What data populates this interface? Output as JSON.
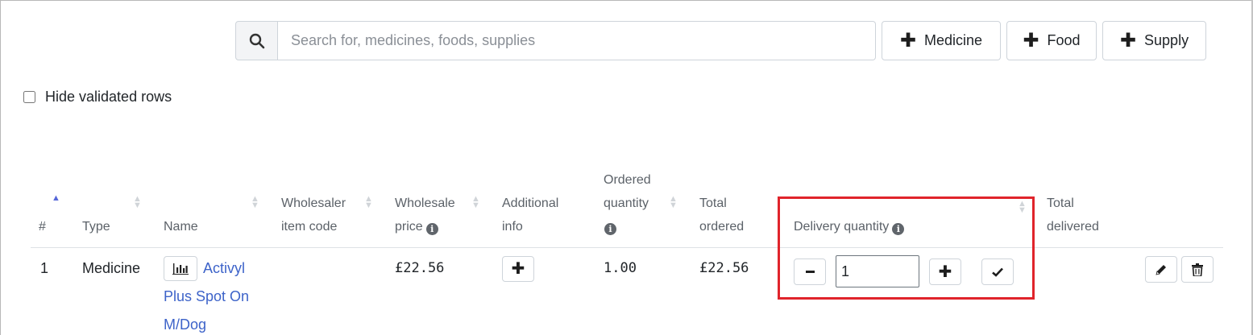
{
  "search": {
    "placeholder": "Search for, medicines, foods, supplies",
    "icon": "search-icon"
  },
  "add_buttons": {
    "medicine": "Medicine",
    "food": "Food",
    "supply": "Supply"
  },
  "filters": {
    "hide_validated_label": "Hide validated rows",
    "hide_validated_checked": false
  },
  "table": {
    "headers": {
      "index": "#",
      "type": "Type",
      "name": "Name",
      "wholesaler_code_1": "Wholesaler",
      "wholesaler_code_2": "item code",
      "wholesale_price_1": "Wholesale",
      "wholesale_price_2": "price",
      "additional_info_1": "Additional",
      "additional_info_2": "info",
      "ordered_qty_1": "Ordered",
      "ordered_qty_2": "quantity",
      "total_ordered_1": "Total",
      "total_ordered_2": "ordered",
      "delivery_qty": "Delivery quantity",
      "total_delivered_1": "Total",
      "total_delivered_2": "delivered"
    },
    "sort": {
      "column": "index",
      "direction": "ascending"
    },
    "rows": [
      {
        "index": "1",
        "type": "Medicine",
        "name_line1": "Activyl",
        "name_line2": "Plus Spot On",
        "name_line3": "M/Dog",
        "wholesaler_item_code": "",
        "wholesale_price": "£22.56",
        "ordered_quantity": "1.00",
        "total_ordered": "£22.56",
        "delivery_quantity": "1",
        "total_delivered": ""
      }
    ]
  },
  "colors": {
    "link": "#3d63c9",
    "highlight": "#e0242b",
    "sort_active": "#5667d8"
  }
}
